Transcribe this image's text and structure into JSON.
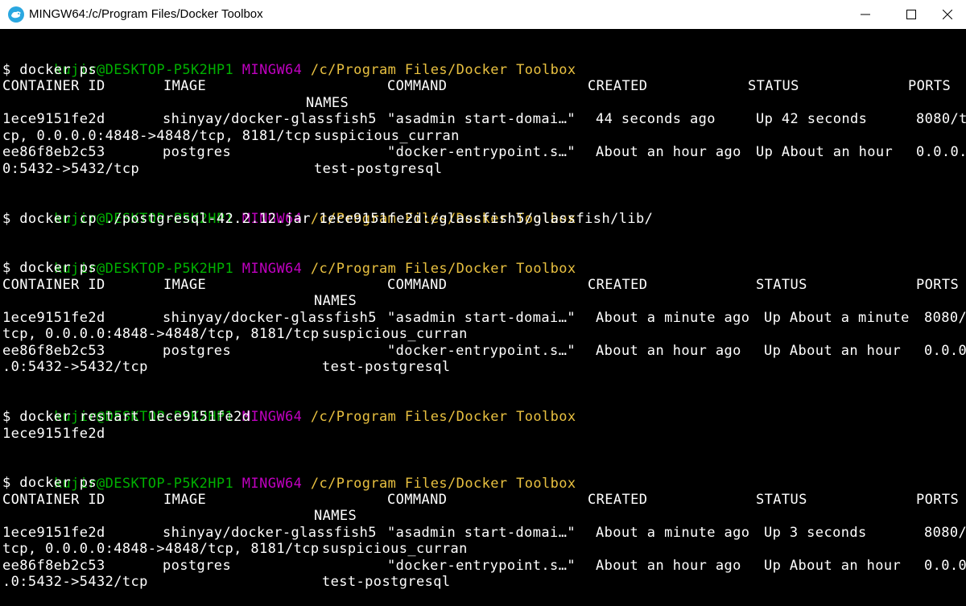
{
  "window": {
    "title": "MINGW64:/c/Program Files/Docker Toolbox",
    "icon": "mingw-terminal-icon",
    "controls": {
      "minimize": "minimize-icon",
      "maximize": "maximize-icon",
      "close": "close-icon"
    }
  },
  "colors": {
    "background": "#000000",
    "text": "#ffffff",
    "prompt_user": "#00b000",
    "prompt_system": "#c000c0",
    "prompt_path": "#e8c040"
  },
  "prompt": {
    "user": "kujir@DESKTOP-P5K2HP1",
    "system": "MINGW64",
    "path": "/c/Program Files/Docker Toolbox"
  },
  "commands": {
    "ps1": "$ docker ps",
    "cp": "$ docker cp ./postgresql-42.2.12.jar 1ece9151fe2d:/glassfish5/glassfish/lib/",
    "ps2": "$ docker ps",
    "restart": "$ docker restart 1ece9151fe2d",
    "restart_output": "1ece9151fe2d",
    "ps3": "$ docker ps"
  },
  "ps_header": {
    "container_id": "CONTAINER ID",
    "image": "IMAGE",
    "command": "COMMAND",
    "created": "CREATED",
    "status": "STATUS",
    "ports": "PORTS",
    "names": "NAMES"
  },
  "ps1_rows": [
    {
      "container_id": "1ece9151fe2d",
      "image": "shinyay/docker-glassfish5",
      "command": "\"asadmin start-domai…\"",
      "created": "44 seconds ago",
      "status": "Up 42 seconds",
      "ports_start": "8080/t",
      "ports_cont": "cp, 0.0.0.0:4848->4848/tcp, 8181/tcp",
      "names": "suspicious_curran"
    },
    {
      "container_id": "ee86f8eb2c53",
      "image": "postgres",
      "command": "\"docker-entrypoint.s…\"",
      "created": "About an hour ago",
      "status": "Up About an hour",
      "ports_start": "0.0.0.",
      "ports_cont": "0:5432->5432/tcp",
      "names": "test-postgresql"
    }
  ],
  "ps2_rows": [
    {
      "container_id": "1ece9151fe2d",
      "image": "shinyay/docker-glassfish5",
      "command": "\"asadmin start-domai…\"",
      "created": "About a minute ago",
      "status": "Up About a minute",
      "ports_start": "8080/",
      "ports_cont": "tcp, 0.0.0.0:4848->4848/tcp, 8181/tcp",
      "names": "suspicious_curran"
    },
    {
      "container_id": "ee86f8eb2c53",
      "image": "postgres",
      "command": "\"docker-entrypoint.s…\"",
      "created": "About an hour ago",
      "status": "Up About an hour",
      "ports_start": "0.0.0",
      "ports_cont": ".0:5432->5432/tcp",
      "names": "test-postgresql"
    }
  ],
  "ps3_rows": [
    {
      "container_id": "1ece9151fe2d",
      "image": "shinyay/docker-glassfish5",
      "command": "\"asadmin start-domai…\"",
      "created": "About a minute ago",
      "status": "Up 3 seconds",
      "ports_start": "8080/",
      "ports_cont": "tcp, 0.0.0.0:4848->4848/tcp, 8181/tcp",
      "names": "suspicious_curran"
    },
    {
      "container_id": "ee86f8eb2c53",
      "image": "postgres",
      "command": "\"docker-entrypoint.s…\"",
      "created": "About an hour ago",
      "status": "Up About an hour",
      "ports_start": "0.0.0",
      "ports_cont": ".0:5432->5432/tcp",
      "names": "test-postgresql"
    }
  ]
}
